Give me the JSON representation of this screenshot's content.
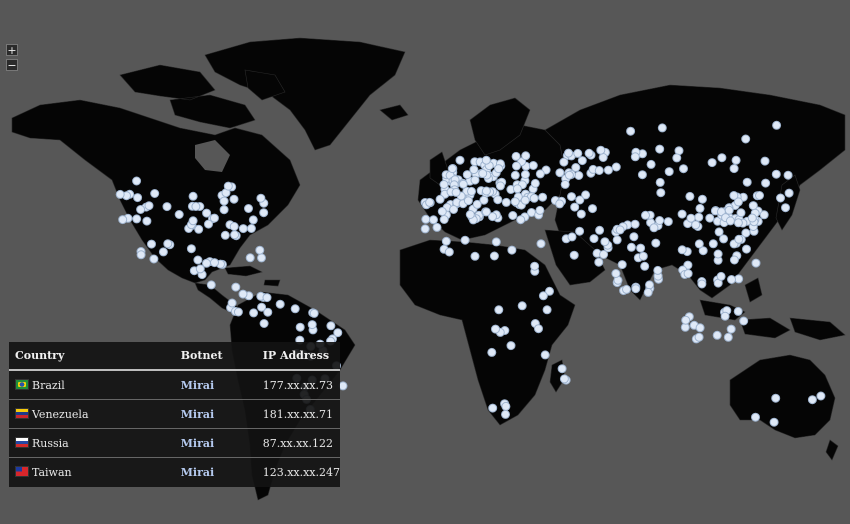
{
  "map": {
    "zoom_in_label": "+",
    "zoom_out_label": "−",
    "land_color": "#050505",
    "ocean_color": "#575757",
    "marker_color": "#dfe9f7"
  },
  "table": {
    "headers": [
      "Country",
      "Botnet",
      "IP Address"
    ],
    "rows": [
      {
        "country": "Brazil",
        "flag": "brazil-flag-icon",
        "botnet": "Mirai",
        "ip": "177.xx.xx.73"
      },
      {
        "country": "Venezuela",
        "flag": "venezuela-flag-icon",
        "botnet": "Mirai",
        "ip": "181.xx.xx.71"
      },
      {
        "country": "Russia",
        "flag": "russia-flag-icon",
        "botnet": "Mirai",
        "ip": "87.xx.xx.122"
      },
      {
        "country": "Taiwan",
        "flag": "taiwan-flag-icon",
        "botnet": "Mirai",
        "ip": "123.xx.xx.247"
      }
    ]
  }
}
